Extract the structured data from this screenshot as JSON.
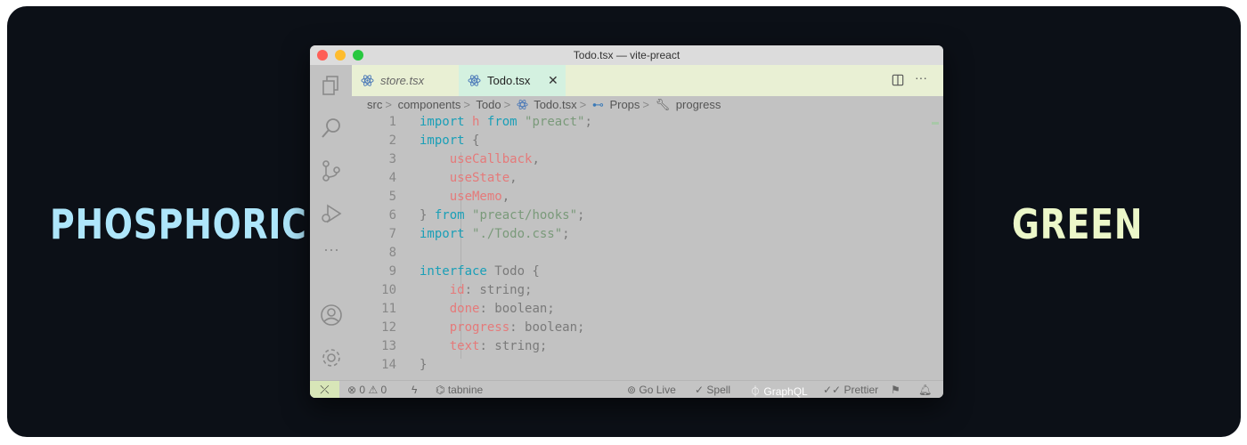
{
  "banner": {
    "left_word": "PHOSPHORIC",
    "right_word": "GREEN",
    "left_color": "#aee6fb",
    "right_color": "#ecf7c9",
    "background": "#0c1017"
  },
  "window": {
    "title": "Todo.tsx — vite-preact"
  },
  "activity_bar": {
    "icons": [
      "files-icon",
      "search-icon",
      "source-control-icon",
      "run-debug-icon",
      "more-icon",
      "account-icon",
      "settings-gear-icon"
    ]
  },
  "tabs": [
    {
      "label": "store.tsx",
      "icon": "react-icon",
      "active": false
    },
    {
      "label": "Todo.tsx",
      "icon": "react-icon",
      "active": true,
      "close": "✕"
    }
  ],
  "breadcrumb": {
    "items": [
      "src",
      "components",
      "Todo",
      "Todo.tsx",
      "Props",
      "progress"
    ],
    "separator": ">"
  },
  "editor": {
    "lines": [
      {
        "num": "1",
        "tokens": [
          [
            "kw",
            "import"
          ],
          [
            "plain",
            " "
          ],
          [
            "var",
            "h"
          ],
          [
            "plain",
            " "
          ],
          [
            "kw",
            "from"
          ],
          [
            "plain",
            " "
          ],
          [
            "str",
            "\"preact\""
          ],
          [
            "plain",
            ";"
          ]
        ]
      },
      {
        "num": "2",
        "tokens": [
          [
            "kw",
            "import"
          ],
          [
            "plain",
            " {"
          ]
        ]
      },
      {
        "num": "3",
        "tokens": [
          [
            "plain",
            "    "
          ],
          [
            "var",
            "useCallback"
          ],
          [
            "plain",
            ","
          ]
        ]
      },
      {
        "num": "4",
        "tokens": [
          [
            "plain",
            "    "
          ],
          [
            "var",
            "useState"
          ],
          [
            "plain",
            ","
          ]
        ]
      },
      {
        "num": "5",
        "tokens": [
          [
            "plain",
            "    "
          ],
          [
            "var",
            "useMemo"
          ],
          [
            "plain",
            ","
          ]
        ]
      },
      {
        "num": "6",
        "tokens": [
          [
            "plain",
            "} "
          ],
          [
            "kw",
            "from"
          ],
          [
            "plain",
            " "
          ],
          [
            "str",
            "\"preact/hooks\""
          ],
          [
            "plain",
            ";"
          ]
        ]
      },
      {
        "num": "7",
        "tokens": [
          [
            "kw",
            "import"
          ],
          [
            "plain",
            " "
          ],
          [
            "str",
            "\"./Todo.css\""
          ],
          [
            "plain",
            ";"
          ]
        ]
      },
      {
        "num": "8",
        "tokens": []
      },
      {
        "num": "9",
        "tokens": [
          [
            "kw",
            "interface"
          ],
          [
            "plain",
            " Todo {"
          ]
        ]
      },
      {
        "num": "10",
        "tokens": [
          [
            "plain",
            "    "
          ],
          [
            "var",
            "id"
          ],
          [
            "plain",
            ": string;"
          ]
        ]
      },
      {
        "num": "11",
        "tokens": [
          [
            "plain",
            "    "
          ],
          [
            "var",
            "done"
          ],
          [
            "plain",
            ": boolean;"
          ]
        ]
      },
      {
        "num": "12",
        "tokens": [
          [
            "plain",
            "    "
          ],
          [
            "var",
            "progress"
          ],
          [
            "plain",
            ": boolean;"
          ]
        ]
      },
      {
        "num": "13",
        "tokens": [
          [
            "plain",
            "    "
          ],
          [
            "var",
            "text"
          ],
          [
            "plain",
            ": string;"
          ]
        ]
      },
      {
        "num": "14",
        "tokens": [
          [
            "plain",
            "}"
          ]
        ]
      }
    ]
  },
  "status_bar": {
    "remote_icon": "remote-icon",
    "errors": "0",
    "warnings": "0",
    "tabnine": "tabnine",
    "go_live": "Go Live",
    "spell": "Spell",
    "graphql": "GraphQL",
    "prettier": "Prettier"
  }
}
